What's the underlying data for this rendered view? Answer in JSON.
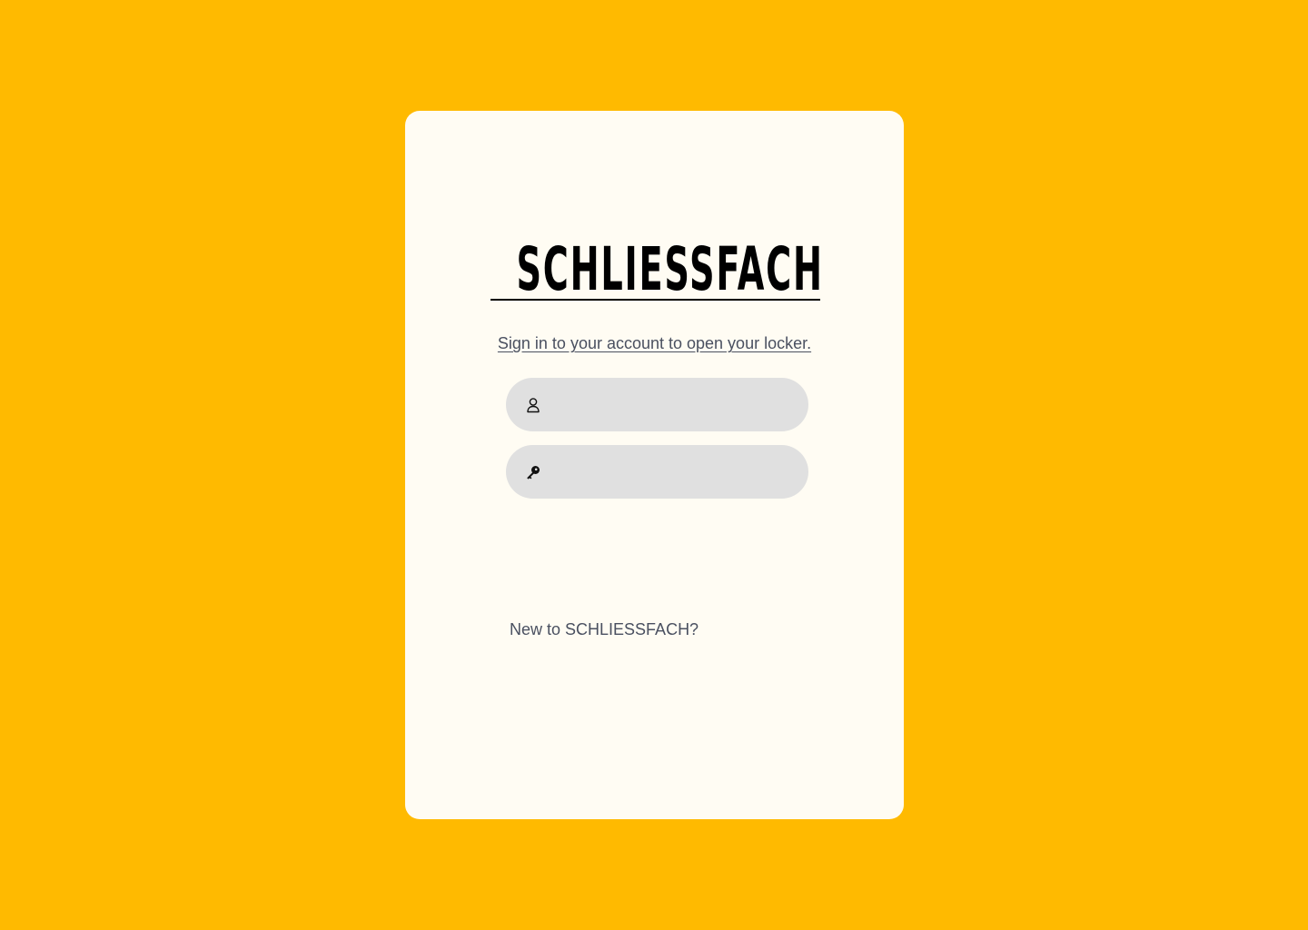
{
  "brand": {
    "name": "SCHLIESSFACH"
  },
  "login": {
    "subtitle": "Sign in to your account to open your locker.",
    "username_field": {
      "icon": "user-icon",
      "value": "",
      "placeholder": ""
    },
    "password_field": {
      "icon": "key-icon",
      "value": "",
      "placeholder": ""
    },
    "signup_prompt": "New to SCHLIESSFACH?"
  },
  "colors": {
    "background": "#FFBA00",
    "card": "#FFFCF3",
    "field": "#E0E0E0",
    "text_muted": "#4A5060"
  }
}
